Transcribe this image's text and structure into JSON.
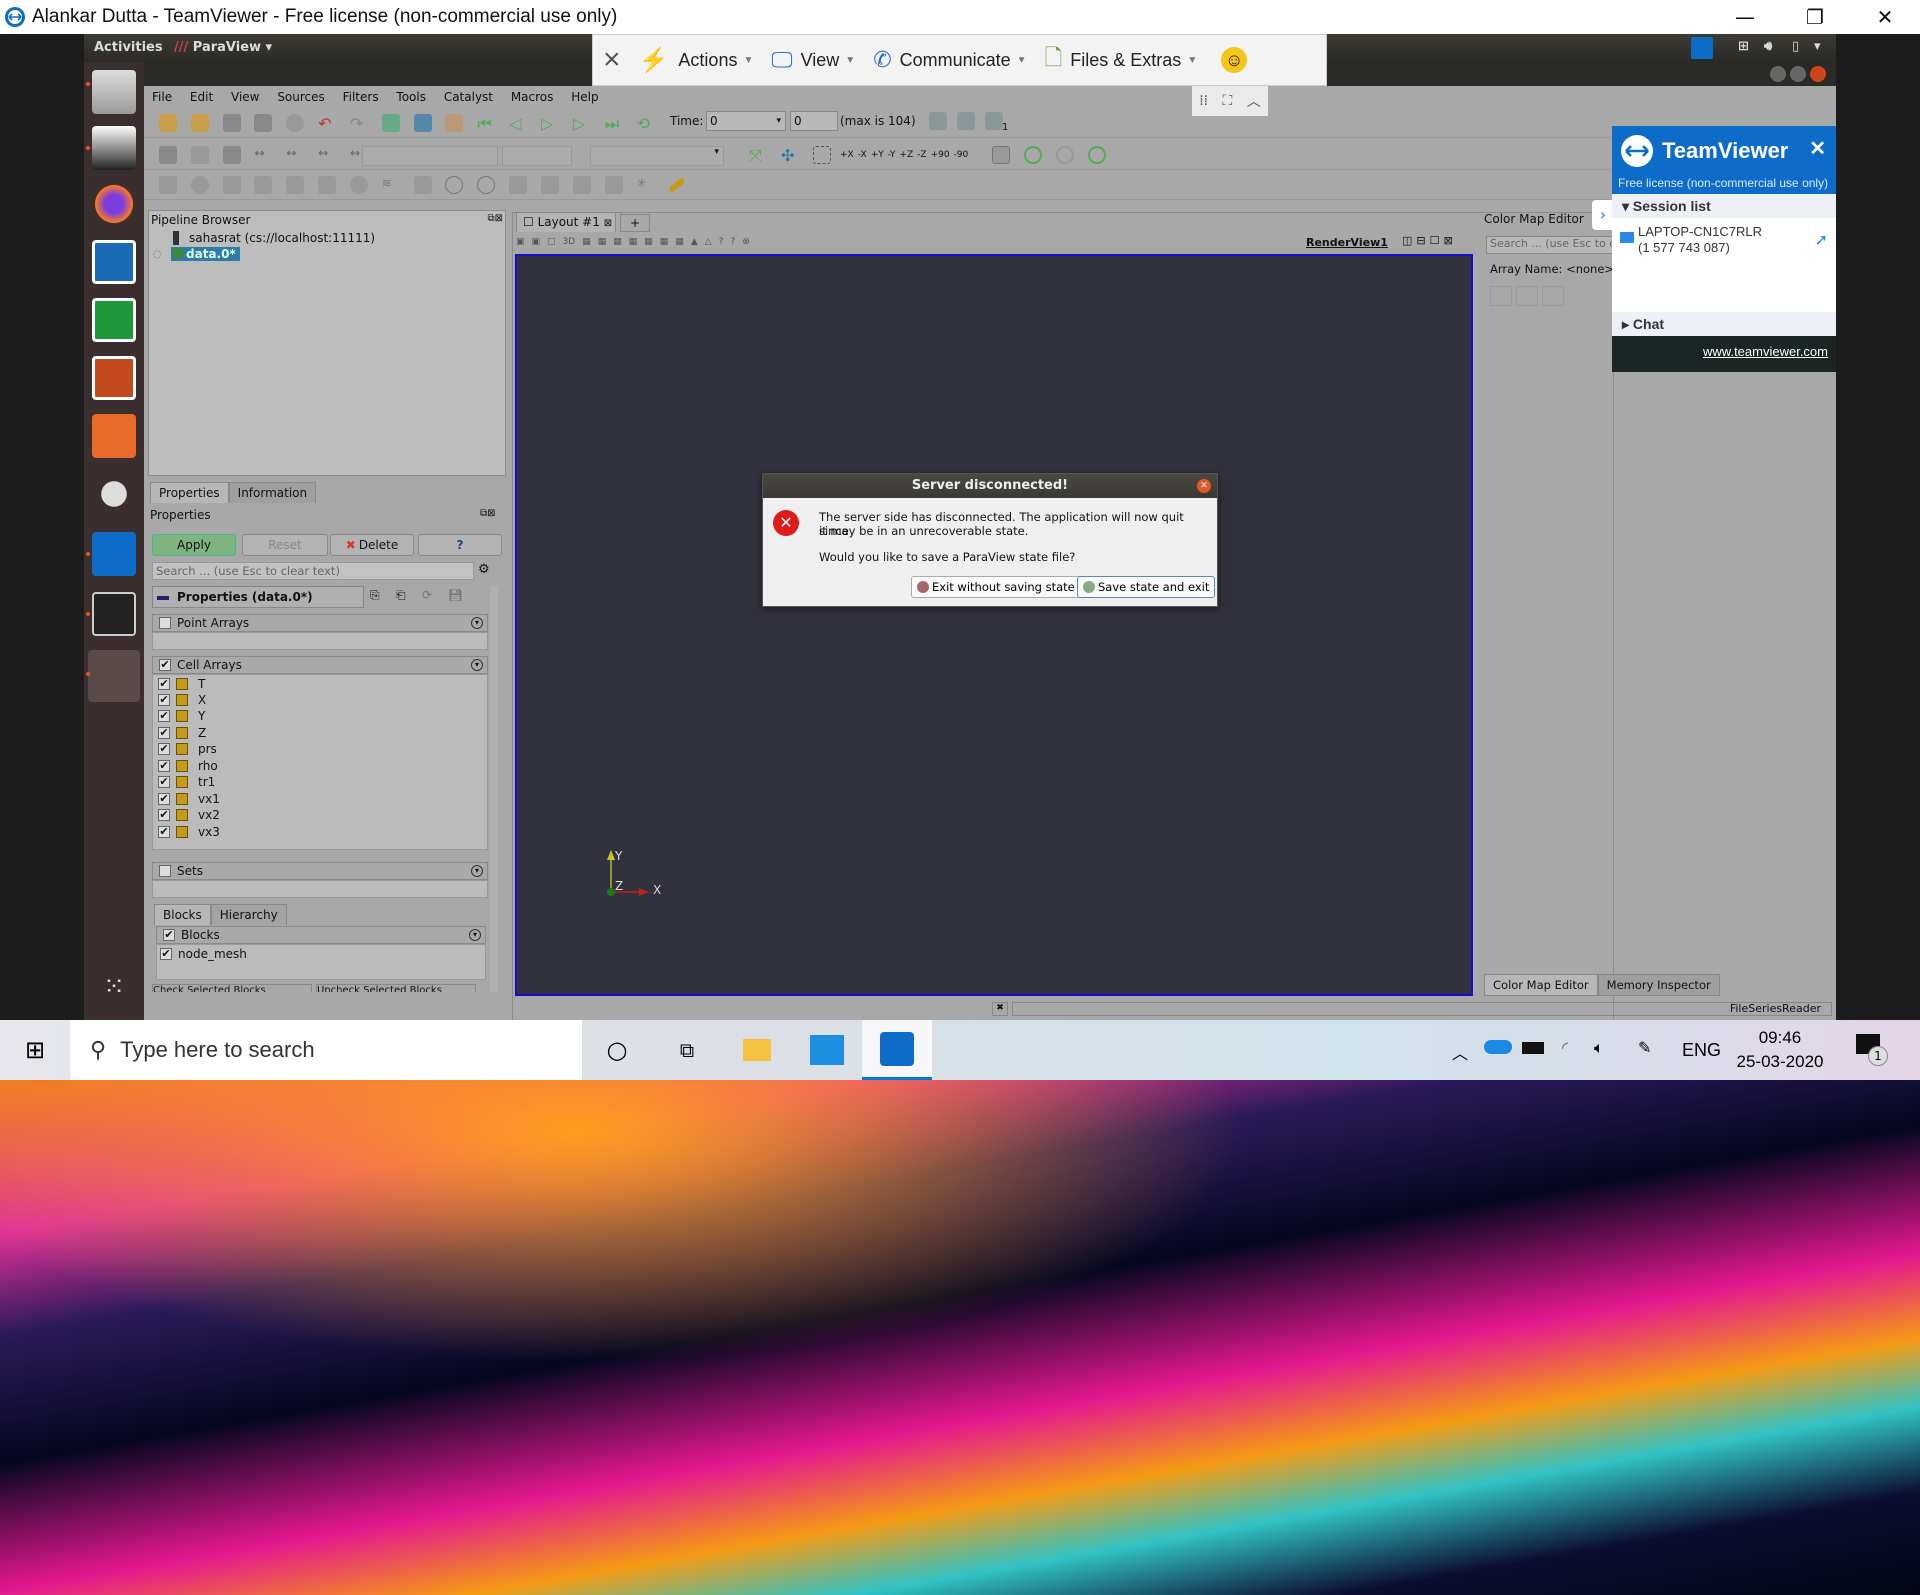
{
  "tv_window": {
    "title": "Alankar Dutta - TeamViewer - Free license (non-commercial use only)",
    "controls": [
      "minimize",
      "restore",
      "close"
    ]
  },
  "gnome_bar": {
    "activities": "Activities",
    "app_menu": "ParaView",
    "tray": [
      "teamviewer-icon",
      "network-icon",
      "volume-icon",
      "battery-icon",
      "menu-caret-icon"
    ]
  },
  "dock": {
    "items": [
      "Files",
      "Remote Desktop",
      "Firefox",
      "LibreOffice Writer",
      "LibreOffice Calc",
      "LibreOffice Impress",
      "Ubuntu Software",
      "System Tools",
      "TeamViewer",
      "Terminal",
      "ParaView",
      "Show Applications"
    ]
  },
  "tv_toolbar": {
    "close": "×",
    "items": [
      {
        "label": "Actions",
        "icon": "lightning-icon"
      },
      {
        "label": "View",
        "icon": "monitor-icon"
      },
      {
        "label": "Communicate",
        "icon": "phone-chat-icon"
      },
      {
        "label": "Files & Extras",
        "icon": "file-puzzle-icon"
      }
    ],
    "emoji": "☺"
  },
  "paraview": {
    "menu": [
      "File",
      "Edit",
      "View",
      "Sources",
      "Filters",
      "Tools",
      "Catalyst",
      "Macros",
      "Help"
    ],
    "time_label": "Time:",
    "time_value": "0",
    "timestep_value": "0",
    "max_label": "(max is 104)",
    "view_count": "1",
    "camera_labels": [
      "+X",
      "-X",
      "+Y",
      "-Y",
      "+Z",
      "-Z",
      "+90",
      "-90"
    ],
    "pipeline": {
      "title": "Pipeline Browser",
      "server": "sahasrat (cs://localhost:11111)",
      "source": "data.0*"
    },
    "tabs": [
      "Properties",
      "Information"
    ],
    "properties": {
      "title": "Properties",
      "apply": "Apply",
      "reset": "Reset",
      "delete": "Delete",
      "help": "?",
      "search_placeholder": "Search ... (use Esc to clear text)",
      "section": "Properties (data.0*)",
      "point_arrays": "Point Arrays",
      "cell_arrays": "Cell Arrays",
      "cell_items": [
        "T",
        "X",
        "Y",
        "Z",
        "prs",
        "rho",
        "tr1",
        "vx1",
        "vx2",
        "vx3"
      ],
      "sets": "Sets",
      "block_tabs": [
        "Blocks",
        "Hierarchy"
      ],
      "blocks_header": "Blocks",
      "block_items": [
        "node_mesh"
      ],
      "bottom_buttons": [
        "Check Selected Blocks",
        "Uncheck Selected Blocks"
      ]
    },
    "layout_tab": "Layout #1",
    "add_tab": "+",
    "render_view": "RenderView1",
    "view_3d": "3D",
    "axes": {
      "x": "X",
      "y": "Y",
      "z": "Z"
    },
    "color_map": {
      "title": "Color Map Editor",
      "search_placeholder": "Search ... (use Esc to clear text)",
      "array_name": "Array Name: <none>"
    },
    "bottom_tabs": [
      "Color Map Editor",
      "Memory Inspector"
    ],
    "status": "FileSeriesReader"
  },
  "dialog": {
    "title": "Server disconnected!",
    "line1": "The server side has disconnected. The application will now quit since",
    "line2": "it may be in an unrecoverable state.",
    "line3": "Would you like to save a ParaView state file?",
    "exit_button": "Exit without saving state",
    "save_button": "Save state and exit"
  },
  "tv_panel": {
    "brand": "TeamViewer",
    "license": "Free license (non-commercial use only)",
    "session_list": "Session list",
    "session_name": "LAPTOP-CN1C7RLR",
    "session_id": "(1 577 743 087)",
    "chat": "Chat",
    "link": "www.teamviewer.com",
    "brand_color": "#0e6cc9"
  },
  "taskbar": {
    "search_placeholder": "Type here to search",
    "apps": [
      "cortana-icon",
      "task-view-icon",
      "file-explorer-icon",
      "mail-icon",
      "teamviewer-icon"
    ],
    "language": "ENG",
    "time": "09:46",
    "date": "25-03-2020",
    "notifications": "1"
  }
}
